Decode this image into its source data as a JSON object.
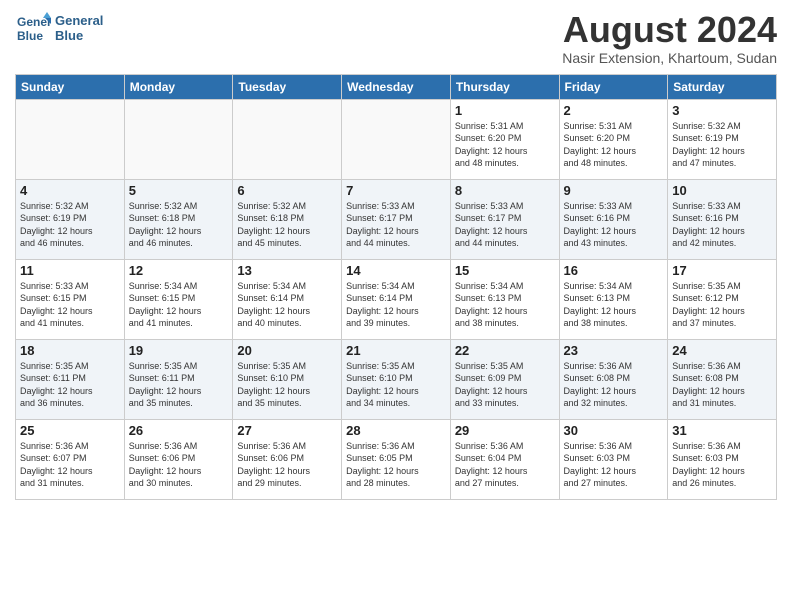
{
  "logo": {
    "line1": "General",
    "line2": "Blue"
  },
  "title": "August 2024",
  "subtitle": "Nasir Extension, Khartoum, Sudan",
  "weekdays": [
    "Sunday",
    "Monday",
    "Tuesday",
    "Wednesday",
    "Thursday",
    "Friday",
    "Saturday"
  ],
  "weeks": [
    [
      {
        "day": "",
        "info": ""
      },
      {
        "day": "",
        "info": ""
      },
      {
        "day": "",
        "info": ""
      },
      {
        "day": "",
        "info": ""
      },
      {
        "day": "1",
        "info": "Sunrise: 5:31 AM\nSunset: 6:20 PM\nDaylight: 12 hours\nand 48 minutes."
      },
      {
        "day": "2",
        "info": "Sunrise: 5:31 AM\nSunset: 6:20 PM\nDaylight: 12 hours\nand 48 minutes."
      },
      {
        "day": "3",
        "info": "Sunrise: 5:32 AM\nSunset: 6:19 PM\nDaylight: 12 hours\nand 47 minutes."
      }
    ],
    [
      {
        "day": "4",
        "info": "Sunrise: 5:32 AM\nSunset: 6:19 PM\nDaylight: 12 hours\nand 46 minutes."
      },
      {
        "day": "5",
        "info": "Sunrise: 5:32 AM\nSunset: 6:18 PM\nDaylight: 12 hours\nand 46 minutes."
      },
      {
        "day": "6",
        "info": "Sunrise: 5:32 AM\nSunset: 6:18 PM\nDaylight: 12 hours\nand 45 minutes."
      },
      {
        "day": "7",
        "info": "Sunrise: 5:33 AM\nSunset: 6:17 PM\nDaylight: 12 hours\nand 44 minutes."
      },
      {
        "day": "8",
        "info": "Sunrise: 5:33 AM\nSunset: 6:17 PM\nDaylight: 12 hours\nand 44 minutes."
      },
      {
        "day": "9",
        "info": "Sunrise: 5:33 AM\nSunset: 6:16 PM\nDaylight: 12 hours\nand 43 minutes."
      },
      {
        "day": "10",
        "info": "Sunrise: 5:33 AM\nSunset: 6:16 PM\nDaylight: 12 hours\nand 42 minutes."
      }
    ],
    [
      {
        "day": "11",
        "info": "Sunrise: 5:33 AM\nSunset: 6:15 PM\nDaylight: 12 hours\nand 41 minutes."
      },
      {
        "day": "12",
        "info": "Sunrise: 5:34 AM\nSunset: 6:15 PM\nDaylight: 12 hours\nand 41 minutes."
      },
      {
        "day": "13",
        "info": "Sunrise: 5:34 AM\nSunset: 6:14 PM\nDaylight: 12 hours\nand 40 minutes."
      },
      {
        "day": "14",
        "info": "Sunrise: 5:34 AM\nSunset: 6:14 PM\nDaylight: 12 hours\nand 39 minutes."
      },
      {
        "day": "15",
        "info": "Sunrise: 5:34 AM\nSunset: 6:13 PM\nDaylight: 12 hours\nand 38 minutes."
      },
      {
        "day": "16",
        "info": "Sunrise: 5:34 AM\nSunset: 6:13 PM\nDaylight: 12 hours\nand 38 minutes."
      },
      {
        "day": "17",
        "info": "Sunrise: 5:35 AM\nSunset: 6:12 PM\nDaylight: 12 hours\nand 37 minutes."
      }
    ],
    [
      {
        "day": "18",
        "info": "Sunrise: 5:35 AM\nSunset: 6:11 PM\nDaylight: 12 hours\nand 36 minutes."
      },
      {
        "day": "19",
        "info": "Sunrise: 5:35 AM\nSunset: 6:11 PM\nDaylight: 12 hours\nand 35 minutes."
      },
      {
        "day": "20",
        "info": "Sunrise: 5:35 AM\nSunset: 6:10 PM\nDaylight: 12 hours\nand 35 minutes."
      },
      {
        "day": "21",
        "info": "Sunrise: 5:35 AM\nSunset: 6:10 PM\nDaylight: 12 hours\nand 34 minutes."
      },
      {
        "day": "22",
        "info": "Sunrise: 5:35 AM\nSunset: 6:09 PM\nDaylight: 12 hours\nand 33 minutes."
      },
      {
        "day": "23",
        "info": "Sunrise: 5:36 AM\nSunset: 6:08 PM\nDaylight: 12 hours\nand 32 minutes."
      },
      {
        "day": "24",
        "info": "Sunrise: 5:36 AM\nSunset: 6:08 PM\nDaylight: 12 hours\nand 31 minutes."
      }
    ],
    [
      {
        "day": "25",
        "info": "Sunrise: 5:36 AM\nSunset: 6:07 PM\nDaylight: 12 hours\nand 31 minutes."
      },
      {
        "day": "26",
        "info": "Sunrise: 5:36 AM\nSunset: 6:06 PM\nDaylight: 12 hours\nand 30 minutes."
      },
      {
        "day": "27",
        "info": "Sunrise: 5:36 AM\nSunset: 6:06 PM\nDaylight: 12 hours\nand 29 minutes."
      },
      {
        "day": "28",
        "info": "Sunrise: 5:36 AM\nSunset: 6:05 PM\nDaylight: 12 hours\nand 28 minutes."
      },
      {
        "day": "29",
        "info": "Sunrise: 5:36 AM\nSunset: 6:04 PM\nDaylight: 12 hours\nand 27 minutes."
      },
      {
        "day": "30",
        "info": "Sunrise: 5:36 AM\nSunset: 6:03 PM\nDaylight: 12 hours\nand 27 minutes."
      },
      {
        "day": "31",
        "info": "Sunrise: 5:36 AM\nSunset: 6:03 PM\nDaylight: 12 hours\nand 26 minutes."
      }
    ]
  ]
}
